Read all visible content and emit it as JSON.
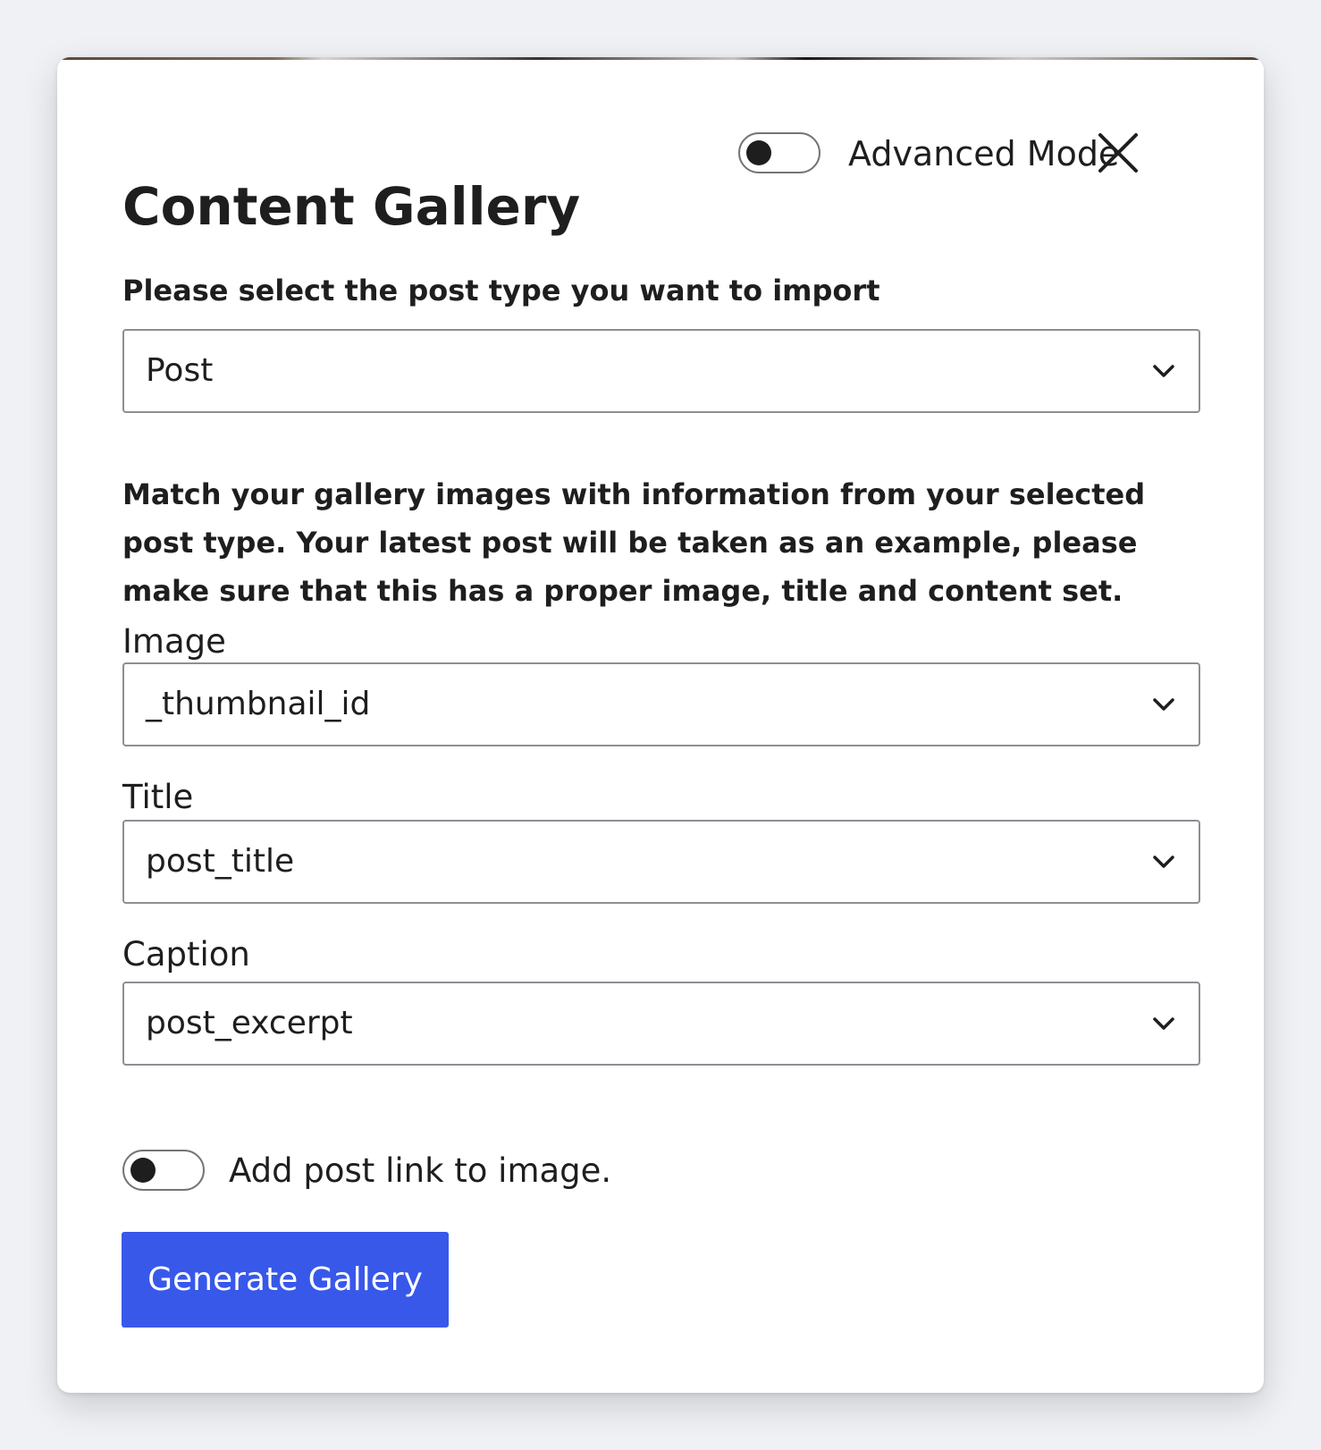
{
  "modal": {
    "title": "Content Gallery",
    "advanced_mode": {
      "label": "Advanced Mode",
      "enabled": false
    },
    "close_icon": "close-icon"
  },
  "post_type": {
    "label": "Please select the post type you want to import",
    "selected": "Post"
  },
  "instructions": "Match your gallery images with information from your selected post type. Your latest post will be taken as an example, please make sure that this has a proper image, title and content set.",
  "fields": [
    {
      "label": "Image",
      "selected": "_thumbnail_id"
    },
    {
      "label": "Title",
      "selected": "post_title"
    },
    {
      "label": "Caption",
      "selected": "post_excerpt"
    }
  ],
  "post_link_toggle": {
    "label": "Add post link to image.",
    "enabled": false
  },
  "generate_button": {
    "label": "Generate Gallery"
  },
  "colors": {
    "primary": "#3858e9",
    "text": "#1e1e1e",
    "border": "#8c8f94",
    "backdrop": "#f0f1f5"
  }
}
